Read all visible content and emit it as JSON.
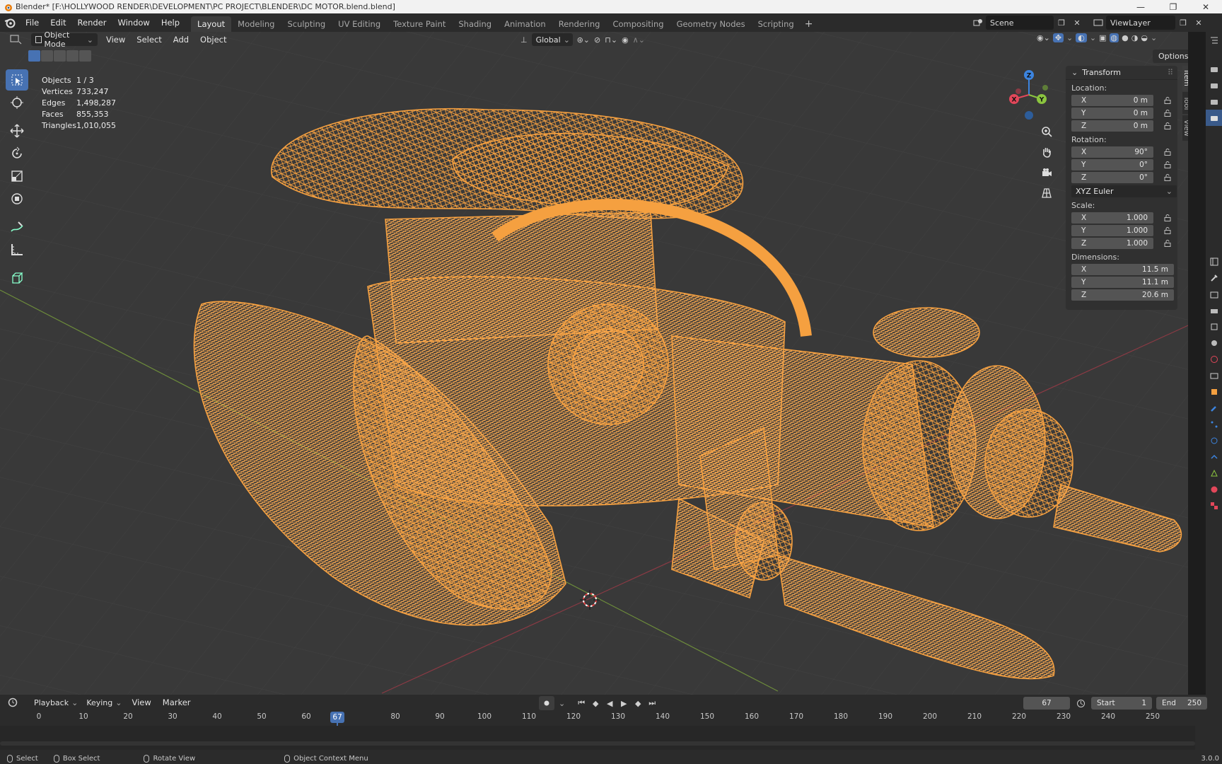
{
  "window": {
    "title": "Blender* [F:\\HOLLYWOOD RENDER\\DEVELOPMENT\\PC PROJECT\\BLENDER\\DC MOTOR.blend.blend]",
    "controls": [
      "—",
      "❐",
      "✕"
    ]
  },
  "menus": [
    "File",
    "Edit",
    "Render",
    "Window",
    "Help"
  ],
  "workspaces": [
    "Layout",
    "Modeling",
    "Sculpting",
    "UV Editing",
    "Texture Paint",
    "Shading",
    "Animation",
    "Rendering",
    "Compositing",
    "Geometry Nodes",
    "Scripting"
  ],
  "active_workspace": "Layout",
  "scene": {
    "name": "Scene",
    "view_layer": "ViewLayer"
  },
  "viewport_header": {
    "mode": "Object Mode",
    "menus": [
      "View",
      "Select",
      "Add",
      "Object"
    ],
    "orientation": "Global",
    "options": "Options"
  },
  "stats": [
    {
      "key": "Objects",
      "value": "1 / 3"
    },
    {
      "key": "Vertices",
      "value": "733,247"
    },
    {
      "key": "Edges",
      "value": "1,498,287"
    },
    {
      "key": "Faces",
      "value": "855,353"
    },
    {
      "key": "Triangles",
      "value": "1,010,055"
    }
  ],
  "gizmo": {
    "x": "X",
    "y": "Y",
    "z": "Z"
  },
  "npanel": {
    "tabs": [
      "Item",
      "Tool",
      "View"
    ],
    "section": "Transform",
    "location_label": "Location:",
    "location": [
      {
        "axis": "X",
        "value": "0 m"
      },
      {
        "axis": "Y",
        "value": "0 m"
      },
      {
        "axis": "Z",
        "value": "0 m"
      }
    ],
    "rotation_label": "Rotation:",
    "rotation": [
      {
        "axis": "X",
        "value": "90°"
      },
      {
        "axis": "Y",
        "value": "0°"
      },
      {
        "axis": "Z",
        "value": "0°"
      }
    ],
    "rotation_mode": "XYZ Euler",
    "scale_label": "Scale:",
    "scale": [
      {
        "axis": "X",
        "value": "1.000"
      },
      {
        "axis": "Y",
        "value": "1.000"
      },
      {
        "axis": "Z",
        "value": "1.000"
      }
    ],
    "dimensions_label": "Dimensions:",
    "dimensions": [
      {
        "axis": "X",
        "value": "11.5 m"
      },
      {
        "axis": "Y",
        "value": "11.1 m"
      },
      {
        "axis": "Z",
        "value": "20.6 m"
      }
    ]
  },
  "timeline": {
    "menus": [
      "Playback",
      "Keying",
      "View",
      "Marker"
    ],
    "current_frame": "67",
    "start_label": "Start",
    "start": "1",
    "end_label": "End",
    "end": "250",
    "ticks": [
      "0",
      "10",
      "20",
      "30",
      "40",
      "50",
      "60",
      "70",
      "80",
      "90",
      "100",
      "110",
      "120",
      "130",
      "140",
      "150",
      "160",
      "170",
      "180",
      "190",
      "200",
      "210",
      "220",
      "230",
      "240",
      "250"
    ]
  },
  "statusbar": {
    "items": [
      "Select",
      "Box Select",
      "Rotate View",
      "Object Context Menu"
    ],
    "version": "3.0.0"
  },
  "colors": {
    "selection_orange": "#f5a040",
    "active_blue": "#4772b3",
    "viewport_bg": "#393939",
    "axis_x": "#e3475a",
    "axis_y": "#8bc53f",
    "axis_z": "#3c84df"
  }
}
